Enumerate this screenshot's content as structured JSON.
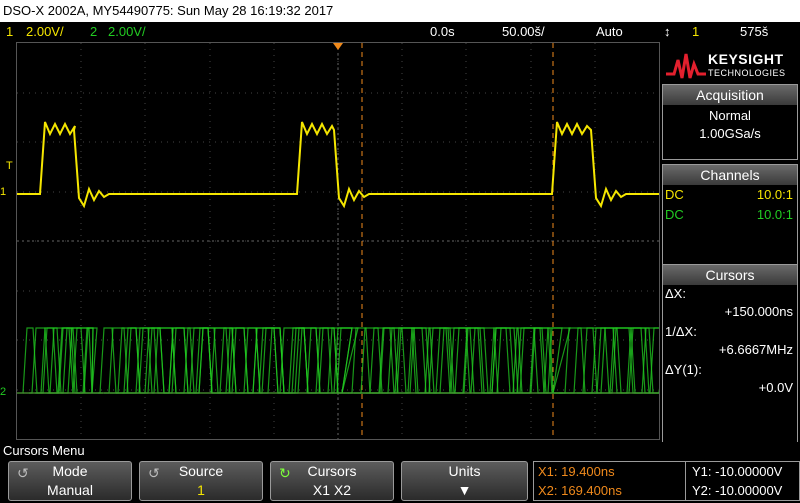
{
  "title_bar": "DSO-X 2002A, MY54490775: Sun May 28 16:19:32 2017",
  "status": {
    "ch1_num": "1",
    "ch1_scale": "2.00V/",
    "ch2_num": "2",
    "ch2_scale": "2.00V/",
    "time_pos": "0.0s",
    "timebase": "50.00š/",
    "trigger_mode": "Auto",
    "trigger_icon": "↕",
    "trigger_src": "1",
    "trigger_level": "575š"
  },
  "brand": {
    "name": "KEYSIGHT",
    "sub": "TECHNOLOGIES",
    "color": "#e4202e"
  },
  "acquisition": {
    "header": "Acquisition",
    "mode": "Normal",
    "rate": "1.00GSa/s"
  },
  "channels": {
    "header": "Channels",
    "rows": [
      {
        "coupling": "DC",
        "probe": "10.0:1",
        "color": "#f5e600"
      },
      {
        "coupling": "DC",
        "probe": "10.0:1",
        "color": "#22cc22"
      }
    ]
  },
  "cursors_panel": {
    "header": "Cursors",
    "dx_label": "ΔX:",
    "dx_value": "+150.000ns",
    "inv_label": "1/ΔX:",
    "inv_value": "+6.6667MHz",
    "dy_label": "ΔY(1):",
    "dy_value": "+0.0V"
  },
  "markers": {
    "ch1": "1",
    "ch2": "2",
    "trig": "T"
  },
  "menu": {
    "title": "Cursors Menu",
    "mode_label": "Mode",
    "mode_value": "Manual",
    "source_label": "Source",
    "source_value": "1",
    "cursors_label": "Cursors",
    "cursors_value": "X1 X2",
    "units_label": "Units"
  },
  "readout": {
    "x1": "X1: 19.400ns",
    "x2": "X2: 169.400ns",
    "y1": "Y1: -10.00000V",
    "y2": "Y2: -10.00000V"
  },
  "colors": {
    "ch1": "#f5e600",
    "ch2": "#22cc22",
    "cursor": "#f08a1c",
    "accent": "#f5e600"
  }
}
